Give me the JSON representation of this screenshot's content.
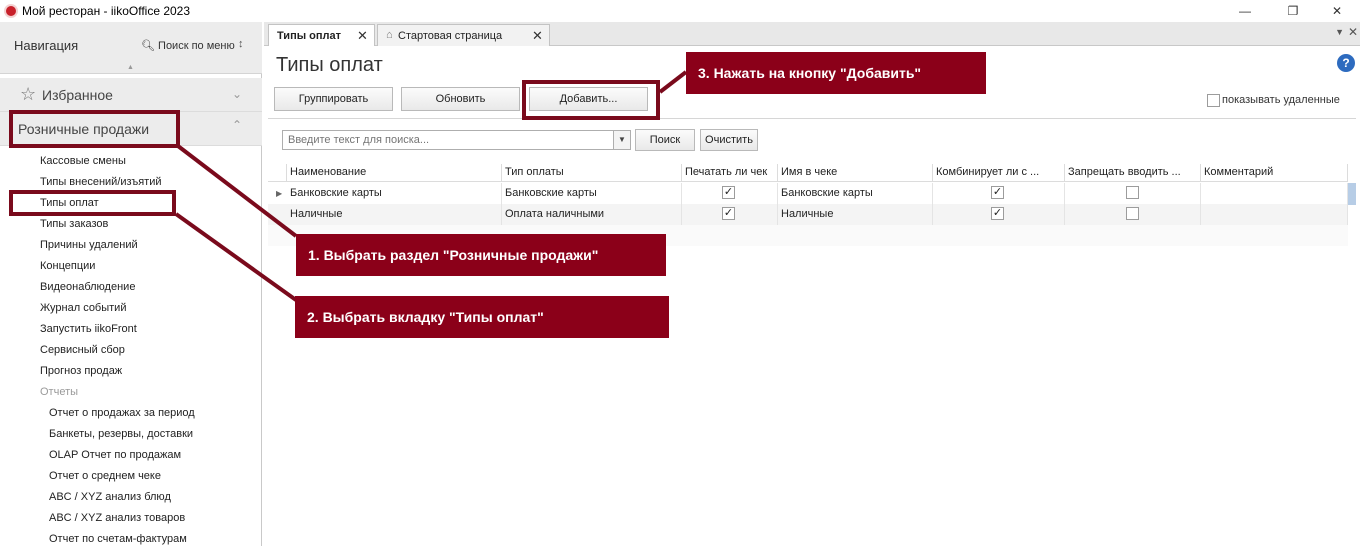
{
  "window": {
    "title": "Мой ресторан - iikoOffice 2023",
    "minimize": "—",
    "restore": "❐",
    "close": "✕"
  },
  "sidebar": {
    "title": "Навигация",
    "search_label": "Поиск по меню",
    "pin_icon": "pin-icon",
    "favorites": "Избранное",
    "retail": "Розничные продажи",
    "items": [
      "Кассовые смены",
      "Типы внесений/изъятий",
      "Типы оплат",
      "Типы заказов",
      "Причины удалений",
      "Концепции",
      "Видеонаблюдение",
      "Журнал событий",
      "Запустить iikoFront",
      "Сервисный сбор",
      "Прогноз продаж"
    ],
    "reports_label": "Отчеты",
    "reports": [
      "Отчет о продажах за период",
      "Банкеты, резервы, доставки",
      "OLAP Отчет по продажам",
      "Отчет о среднем чеке",
      "ABC / XYZ анализ блюд",
      "ABC / XYZ анализ товаров",
      "Отчет по счетам-фактурам"
    ]
  },
  "tabs": [
    {
      "label": "Типы оплат",
      "active": true
    },
    {
      "label": "Стартовая страница",
      "active": false
    }
  ],
  "page": {
    "title": "Типы оплат",
    "buttons": {
      "group": "Группировать",
      "refresh": "Обновить",
      "add": "Добавить..."
    },
    "show_deleted": "показывать удаленные",
    "search_placeholder": "Введите текст для поиска...",
    "search_button": "Поиск",
    "clear_button": "Очистить"
  },
  "grid": {
    "columns": [
      "Наименование",
      "Тип оплаты",
      "Печатать ли чек",
      "Имя в чеке",
      "Комбинирует ли с ...",
      "Запрещать вводить ...",
      "Комментарий"
    ],
    "rows": [
      {
        "name": "Банковские карты",
        "type": "Банковские карты",
        "print": true,
        "receipt_name": "Банковские карты",
        "combine": true,
        "forbid": false,
        "comment": ""
      },
      {
        "name": "Наличные",
        "type": "Оплата наличными",
        "print": true,
        "receipt_name": "Наличные",
        "combine": true,
        "forbid": false,
        "comment": ""
      }
    ]
  },
  "annotations": {
    "step1": "1. Выбрать раздел \"Розничные продажи\"",
    "step2": "2. Выбрать вкладку \"Типы оплат\"",
    "step3": "3. Нажать на кнопку \"Добавить\""
  },
  "colors": {
    "callout": "#8b0019",
    "highlight": "#7a0a1c",
    "help": "#2d6bbf"
  }
}
